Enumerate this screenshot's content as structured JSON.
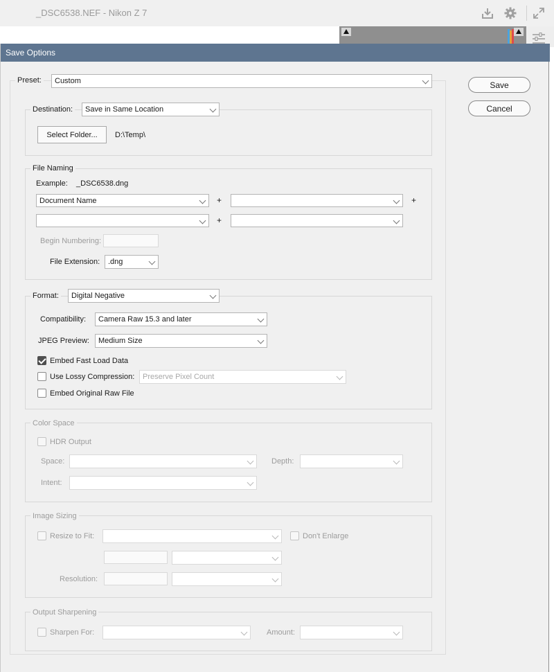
{
  "background": {
    "title": "_DSC6538.NEF  -  Nikon Z 7",
    "icons": [
      "download-icon",
      "gear-icon",
      "expand-icon",
      "sliders-icon"
    ]
  },
  "dialog": {
    "title": "Save Options",
    "buttons": {
      "save": "Save",
      "cancel": "Cancel"
    },
    "preset": {
      "label": "Preset:",
      "value": "Custom"
    },
    "destination": {
      "label": "Destination:",
      "value": "Save in Same Location",
      "select_folder": "Select Folder...",
      "path": "D:\\Temp\\"
    },
    "file_naming": {
      "legend": "File Naming",
      "example_label": "Example:",
      "example_value": "_DSC6538.dng",
      "field1": "Document Name",
      "field2": "",
      "field3": "",
      "field4": "",
      "plus": "+",
      "begin_numbering_label": "Begin Numbering:",
      "begin_numbering_value": "",
      "extension_label": "File Extension:",
      "extension_value": ".dng"
    },
    "format": {
      "label": "Format:",
      "value": "Digital Negative",
      "compatibility_label": "Compatibility:",
      "compatibility_value": "Camera Raw 15.3 and later",
      "jpeg_preview_label": "JPEG Preview:",
      "jpeg_preview_value": "Medium Size",
      "embed_fast_load": "Embed Fast Load Data",
      "embed_fast_load_checked": true,
      "lossy_label": "Use Lossy Compression:",
      "lossy_checked": false,
      "lossy_value": "Preserve Pixel Count",
      "embed_raw": "Embed Original Raw File",
      "embed_raw_checked": false
    },
    "color_space": {
      "legend": "Color Space",
      "hdr_output": "HDR Output",
      "space_label": "Space:",
      "space_value": "",
      "depth_label": "Depth:",
      "depth_value": "",
      "intent_label": "Intent:",
      "intent_value": ""
    },
    "image_sizing": {
      "legend": "Image Sizing",
      "resize_label": "Resize to Fit:",
      "resize_value": "",
      "dont_enlarge": "Don't Enlarge",
      "size_value": "",
      "size_unit": "",
      "resolution_label": "Resolution:",
      "resolution_value": "",
      "resolution_unit": ""
    },
    "output_sharpening": {
      "legend": "Output Sharpening",
      "sharpen_label": "Sharpen For:",
      "sharpen_value": "",
      "amount_label": "Amount:",
      "amount_value": ""
    }
  }
}
